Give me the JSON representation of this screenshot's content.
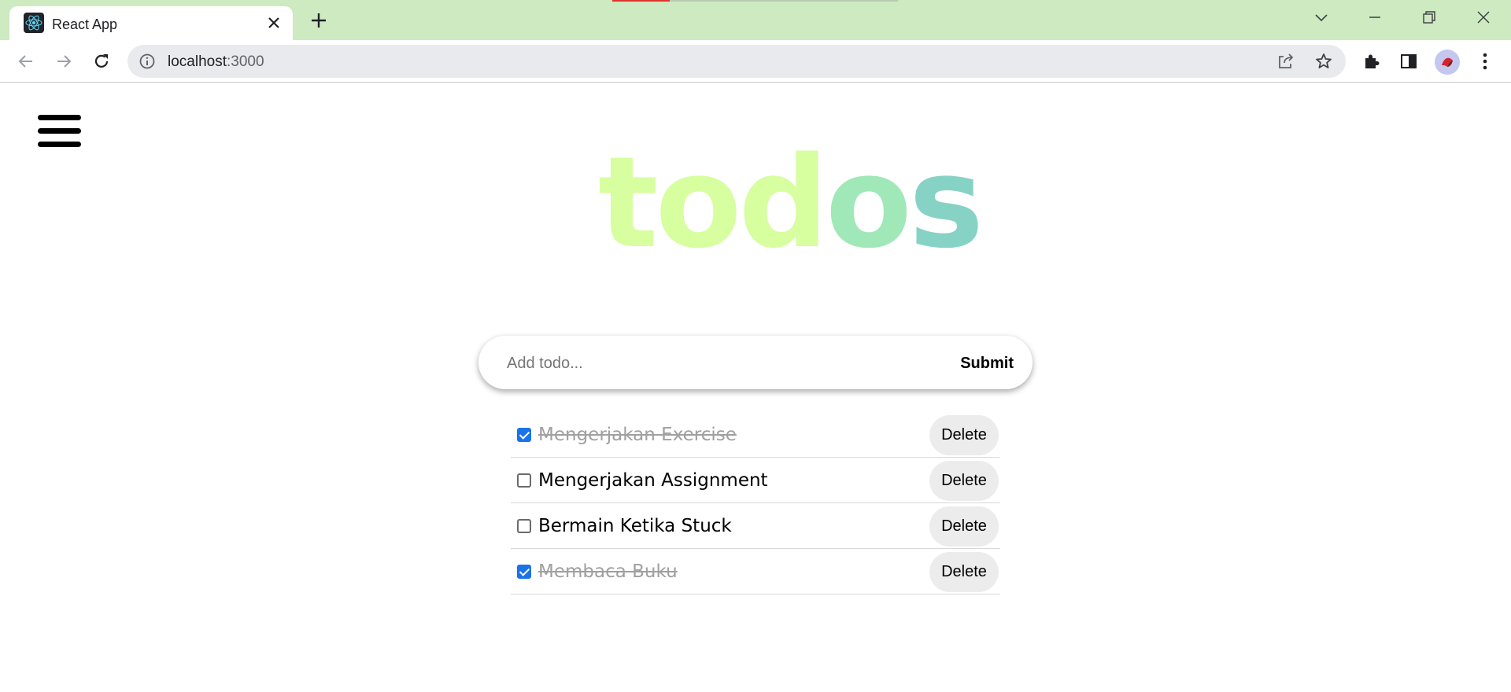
{
  "browser": {
    "tab_title": "React App",
    "url_host": "localhost",
    "url_port": ":3000"
  },
  "app": {
    "logo": {
      "part1": "tod",
      "part2": "o",
      "part3": "s"
    },
    "input_placeholder": "Add todo...",
    "submit_label": "Submit",
    "delete_label": "Delete",
    "todos": [
      {
        "text": "Mengerjakan Exercise",
        "completed": true
      },
      {
        "text": "Mengerjakan Assignment",
        "completed": false
      },
      {
        "text": "Bermain Ketika Stuck",
        "completed": false
      },
      {
        "text": "Membaca Buku",
        "completed": true
      }
    ]
  },
  "colors": {
    "tab_bar": "#cdeac0",
    "logo_1": "#d7fe9f",
    "logo_2": "#a0e8b8",
    "logo_3": "#86d3c5",
    "checkbox_checked": "#1a73e8"
  },
  "icons": [
    "react-favicon",
    "close-icon",
    "plus-icon",
    "chevron-down-icon",
    "minimize-icon",
    "restore-icon",
    "window-close-icon",
    "back-arrow-icon",
    "forward-arrow-icon",
    "reload-icon",
    "info-icon",
    "share-icon",
    "star-icon",
    "extensions-icon",
    "side-panel-icon",
    "avatar",
    "kebab-menu-icon",
    "hamburger-icon"
  ]
}
